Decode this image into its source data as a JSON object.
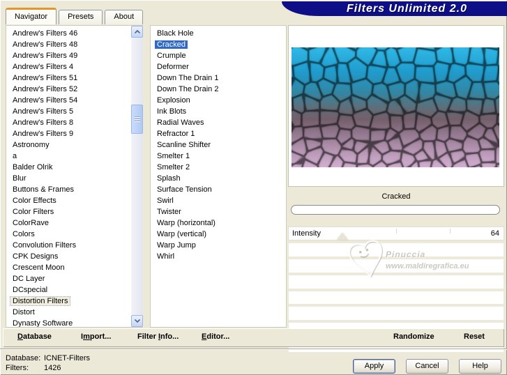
{
  "window_title": "Filters Unlimited 2.0",
  "tabs": [
    {
      "label": "Navigator",
      "active": true
    },
    {
      "label": "Presets",
      "active": false
    },
    {
      "label": "About",
      "active": false
    }
  ],
  "category_list": {
    "selected": "Distortion Filters",
    "items": [
      "Andrew's Filters 46",
      "Andrew's Filters 48",
      "Andrew's Filters 49",
      "Andrew's Filters 4",
      "Andrew's Filters 51",
      "Andrew's Filters 52",
      "Andrew's Filters 54",
      "Andrew's Filters 5",
      "Andrew's Filters 8",
      "Andrew's Filters 9",
      "Astronomy",
      "a",
      "Balder Olrik",
      "Blur",
      "Buttons & Frames",
      "Color Effects",
      "Color Filters",
      "ColorRave",
      "Colors",
      "Convolution Filters",
      "CPK Designs",
      "Crescent Moon",
      "DC Layer",
      "DCspecial",
      "Distortion Filters",
      "Distort",
      "Dynasty Software"
    ]
  },
  "filter_list": {
    "selected": "Cracked",
    "items": [
      "Black Hole",
      "Cracked",
      "Crumple",
      "Deformer",
      "Down The Drain 1",
      "Down The Drain 2",
      "Explosion",
      "Ink Blots",
      "Radial Waves",
      "Refractor 1",
      "Scanline Shifter",
      "Smelter 1",
      "Smelter 2",
      "Splash",
      "Surface Tension",
      "Swirl",
      "Twister",
      "Warp (horizontal)",
      "Warp (vertical)",
      "Warp Jump",
      "Whirl"
    ]
  },
  "preview": {
    "selected_filter_label": "Cracked"
  },
  "parameters": {
    "rows": [
      {
        "label": "Intensity",
        "value": "64",
        "thumb_percent": 25
      }
    ]
  },
  "watermark": {
    "line1": "Pinuccia",
    "line2": "www.maldiregrafica.eu"
  },
  "toolbar": {
    "items": [
      {
        "pre": "",
        "key": "D",
        "post": "atabase"
      },
      {
        "pre": "I",
        "key": "m",
        "post": "port..."
      },
      {
        "pre": "Filter ",
        "key": "I",
        "post": "nfo..."
      },
      {
        "pre": "",
        "key": "E",
        "post": "ditor..."
      }
    ],
    "randomize": "Randomize",
    "reset": "Reset"
  },
  "status": {
    "database_label": "Database:",
    "database_value": "ICNET-Filters",
    "filters_label": "Filters:",
    "filters_value": "1426"
  },
  "action_buttons": {
    "apply": "Apply",
    "cancel": "Cancel",
    "help": "Help"
  },
  "colors": {
    "dialog_bg": "#ECE9D8",
    "selection_blue": "#316AC5",
    "banner_navy": "#0E0E86",
    "tab_accent": "#E5942E"
  }
}
